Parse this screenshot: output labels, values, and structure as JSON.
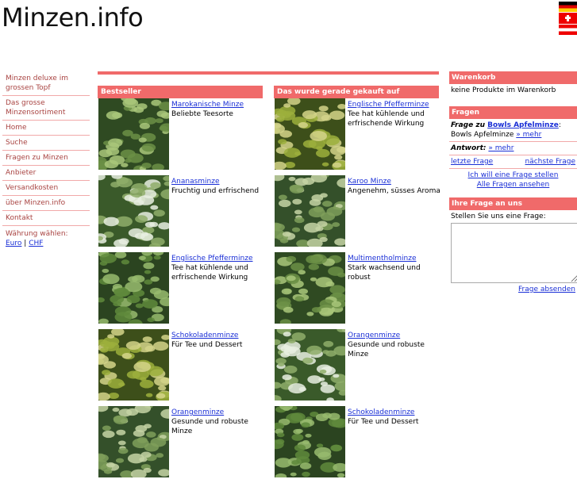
{
  "site": {
    "title": "Minzen.info"
  },
  "flags": [
    {
      "icon": "flag-germany-icon"
    },
    {
      "icon": "flag-switzerland-icon"
    },
    {
      "icon": "flag-austria-icon"
    }
  ],
  "sidebar": {
    "promos": [
      "Minzen deluxe im grossen Topf",
      "Das grosse Minzensortiment"
    ],
    "nav": [
      "Home",
      "Suche",
      "Fragen zu Minzen",
      "Anbieter",
      "Versandkosten",
      "über Minzen.info",
      "Kontakt"
    ],
    "currency_label": "Währung wählen:",
    "currencies": [
      "Euro",
      "CHF"
    ],
    "currency_sep": "|"
  },
  "bestseller": {
    "title": "Bestseller",
    "items": [
      {
        "name": "Marokanische Minze",
        "desc": "Beliebte Teesorte"
      },
      {
        "name": "Ananasminze",
        "desc": "Fruchtig und erfrischend"
      },
      {
        "name": "Englische Pfefferminze",
        "desc": "Tee hat kühlende und erfrischende Wirkung"
      },
      {
        "name": "Schokoladenminze",
        "desc": "Für Tee und Dessert"
      },
      {
        "name": "Orangenminze",
        "desc": "Gesunde und robuste Minze"
      }
    ]
  },
  "recent": {
    "title": "Das wurde gerade gekauft auf Minzen.info",
    "items": [
      {
        "name": "Englische Pfefferminze",
        "desc": "Tee hat kühlende und erfrischende Wirkung"
      },
      {
        "name": "Karoo Minze",
        "desc": "Angenehm, süsses Aroma"
      },
      {
        "name": "Multimenthol­minze",
        "desc": "Stark wachsend und robust"
      },
      {
        "name": "Orangenminze",
        "desc": "Gesunde und robuste Minze"
      },
      {
        "name": "Schokoladenminze",
        "desc": "Für Tee und Dessert"
      }
    ]
  },
  "cart": {
    "title": "Warenkorb",
    "empty_text": "keine Produkte im Warenkorb"
  },
  "questions": {
    "title": "Fragen",
    "question_label": "Frage zu",
    "question_product": "Bowls Apfelminze",
    "question_text": ": Bowls Apfelminze",
    "more": "» mehr",
    "answer_label": "Antwort:",
    "prev": "letzte Frage",
    "next": "nächste Frage",
    "ask": "Ich will eine Frage stellen",
    "all": "Alle Fragen ansehen"
  },
  "ask_form": {
    "title": "Ihre Frage an uns",
    "prompt": "Stellen Sie uns eine Frage:",
    "value": "",
    "submit": "Frage absenden"
  },
  "colors": {
    "accent": "#f06a6a",
    "link": "#1a2fd6",
    "sidebar_text": "#a94442"
  }
}
